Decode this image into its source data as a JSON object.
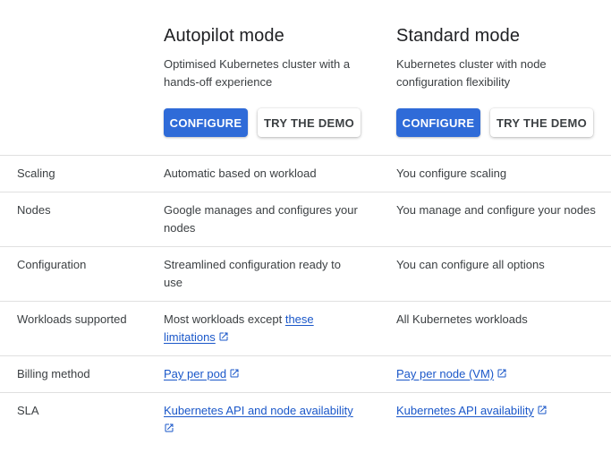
{
  "autopilot": {
    "title": "Autopilot mode",
    "description": "Optimised Kubernetes cluster with a hands-off experience",
    "configure_label": "CONFIGURE",
    "demo_label": "TRY THE DEMO"
  },
  "standard": {
    "title": "Standard mode",
    "description": "Kubernetes cluster with node configuration flexibility",
    "configure_label": "CONFIGURE",
    "demo_label": "TRY THE DEMO"
  },
  "rows": {
    "scaling": {
      "label": "Scaling",
      "autopilot": "Automatic based on workload",
      "standard": "You configure scaling"
    },
    "nodes": {
      "label": "Nodes",
      "autopilot": "Google manages and configures your nodes",
      "standard": "You manage and configure your nodes"
    },
    "configuration": {
      "label": "Configuration",
      "autopilot": "Streamlined configuration ready to use",
      "standard": "You can configure all options"
    },
    "workloads": {
      "label": "Workloads supported",
      "autopilot_prefix": "Most workloads except ",
      "autopilot_link": "these limitations",
      "standard": "All Kubernetes workloads"
    },
    "billing": {
      "label": "Billing method",
      "autopilot_link": "Pay per pod",
      "standard_link": "Pay per node (VM)"
    },
    "sla": {
      "label": "SLA",
      "autopilot_link": "Kubernetes API and node availability",
      "standard_link": "Kubernetes API availability"
    }
  },
  "icons": {
    "external_link": "open-in-new-icon"
  },
  "colors": {
    "primary_button": "#2f6bd8",
    "link": "#1a57c9",
    "divider": "#e0e0e0"
  }
}
